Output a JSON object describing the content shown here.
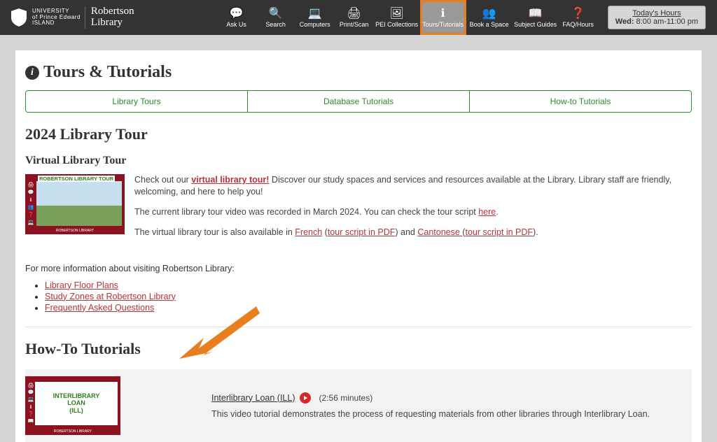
{
  "header": {
    "university_line1": "UNIVERSITY",
    "university_line2": "of Prince Edward",
    "university_line3": "ISLAND",
    "library_line1": "Robertson",
    "library_line2": "Library"
  },
  "nav": [
    {
      "label": "Ask Us",
      "icon": "💬"
    },
    {
      "label": "Search",
      "icon": "🔍"
    },
    {
      "label": "Computers",
      "icon": "💻"
    },
    {
      "label": "Print/Scan",
      "icon": "🖨"
    },
    {
      "label": "PEI Collections",
      "icon": "🖼"
    },
    {
      "label": "Tours/Tutorials",
      "icon": "ℹ",
      "active": true
    },
    {
      "label": "Book a Space",
      "icon": "👥"
    },
    {
      "label": "Subject Guides",
      "icon": "📖"
    },
    {
      "label": "FAQ/Hours",
      "icon": "❓"
    }
  ],
  "hours": {
    "title": "Today's Hours",
    "day": "Wed:",
    "time": "8:00 am-11:00 pm"
  },
  "page_title": "Tours & Tutorials",
  "tabs": [
    "Library Tours",
    "Database Tutorials",
    "How-to Tutorials"
  ],
  "section1": {
    "title": "2024 Library Tour",
    "subtitle": "Virtual Library Tour",
    "thumb_title": "ROBERTSON LIBRARY TOUR",
    "p1_a": "Check out our ",
    "p1_link": "virtual library tour!",
    "p1_b": " Discover our study spaces and services and resources available at the Library. Library staff are friendly, welcoming, and here to help you!",
    "p2_a": "The current library tour video was recorded in March 2024. You can check the tour script ",
    "p2_link": "here",
    "p2_b": ".",
    "p3_a": "The virtual library tour is also available in ",
    "p3_link_fr": "French",
    "p3_b": " (",
    "p3_link_frpdf": "tour script in PDF",
    "p3_c": ") and ",
    "p3_link_can": "Cantonese ",
    "p3_d": " (",
    "p3_link_canpdf": "tour script in PDF",
    "p3_e": ").",
    "info_line": "For more information about visiting Robertson Library:",
    "links": [
      "Library Floor Plans",
      "Study Zones at Robertson Library",
      "Frequently Asked Questions"
    ]
  },
  "section2": {
    "title": "How-To Tutorials",
    "item": {
      "thumb_line1": "INTERLIBRARY",
      "thumb_line2": "LOAN",
      "thumb_line3": "(ILL)",
      "title": "Interlibrary Loan (ILL)",
      "duration": "(2:56 minutes)",
      "desc": "This video tutorial demonstrates the process of requesting materials from other libraries through Interlibrary Loan."
    }
  },
  "thumb_footer": "ROBERTSON LIBRARY"
}
